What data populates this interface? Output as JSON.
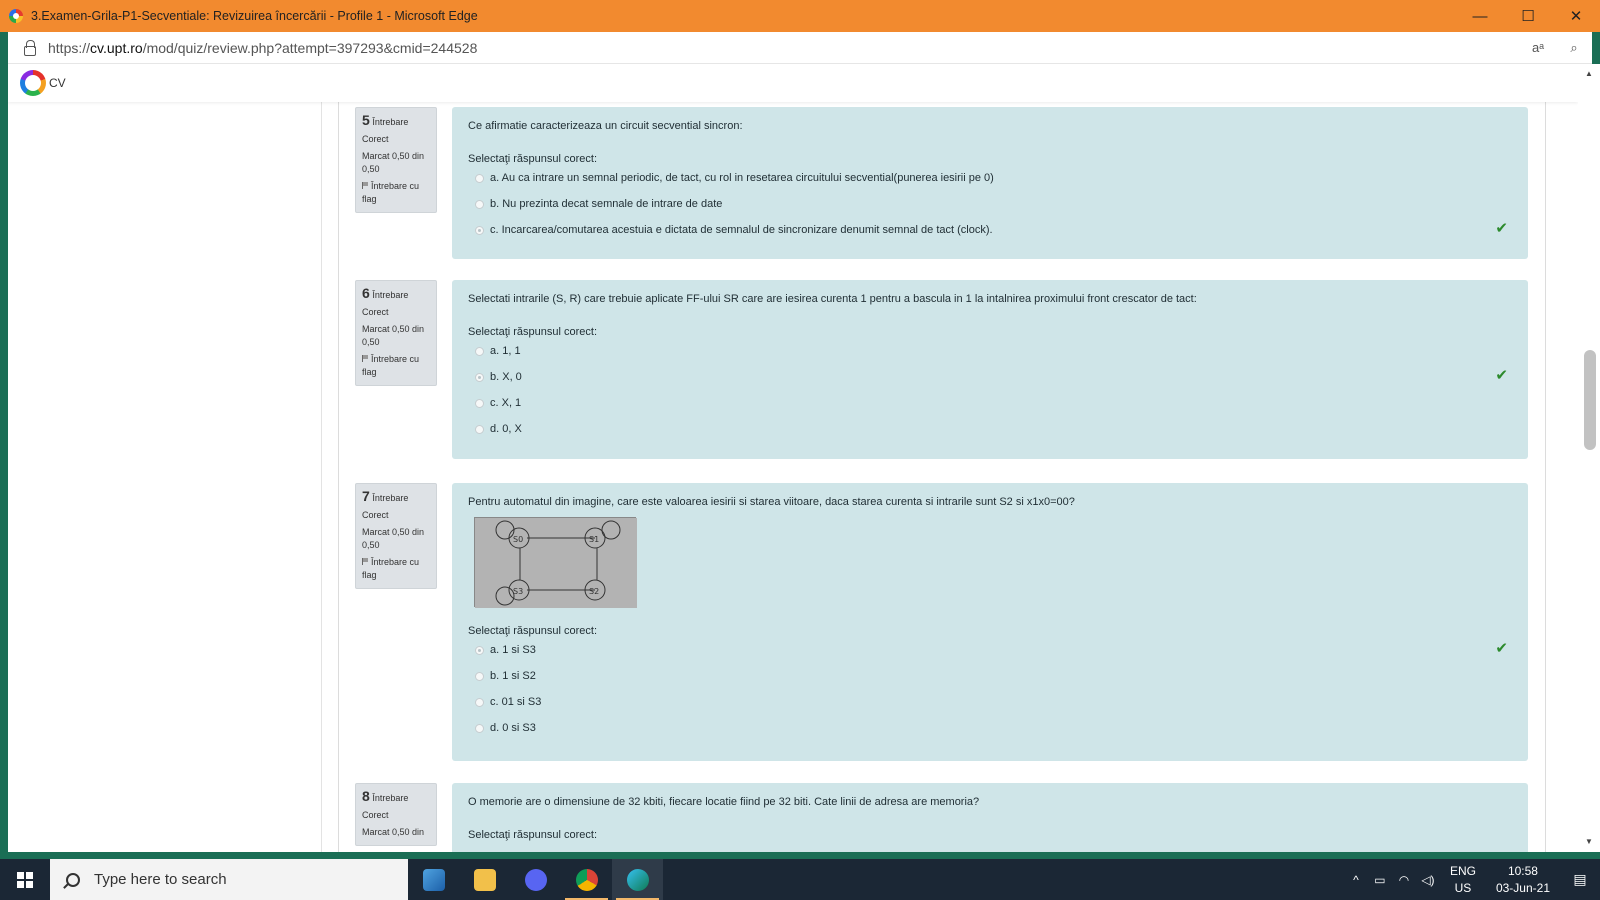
{
  "window": {
    "title": "3.Examen-Grila-P1-Secventiale: Revizuirea încercării - Profile 1 - Microsoft Edge",
    "url_prefix": "https://",
    "url_host": "cv.upt.ro",
    "url_path": "/mod/quiz/review.php?attempt=397293&cmid=244528",
    "minimize": "—",
    "maximize": "☐",
    "close": "✕"
  },
  "site": {
    "logo_text": "CV"
  },
  "questions": [
    {
      "number": "5",
      "word": "Întrebare",
      "state": "Corect",
      "mark": "Marcat 0,50 din 0,50",
      "flag": "Întrebare cu flag",
      "text": "Ce afirmatie caracterizeaza un circuit secvential sincron:",
      "prompt": "Selectaţi răspunsul corect:",
      "answers": [
        "a. Au ca intrare un semnal periodic, de tact, cu rol in resetarea circuitului secvential(punerea iesirii pe 0)",
        "b. Nu prezinta decat semnale de intrare de date",
        "c. Incarcarea/comutarea acestuia e dictata de semnalul de sincronizare denumit semnal de tact (clock)."
      ],
      "selected": 2
    },
    {
      "number": "6",
      "word": "Întrebare",
      "state": "Corect",
      "mark": "Marcat 0,50 din 0,50",
      "flag": "Întrebare cu flag",
      "text": "Selectati intrarile (S, R) care trebuie aplicate FF-ului SR care are iesirea curenta 1 pentru a bascula in 1 la intalnirea proximului front crescator de tact:",
      "prompt": "Selectaţi răspunsul corect:",
      "answers": [
        "a. 1, 1",
        "b. X, 0",
        "c. X, 1",
        "d. 0, X"
      ],
      "selected": 1
    },
    {
      "number": "7",
      "word": "Întrebare",
      "state": "Corect",
      "mark": "Marcat 0,50 din 0,50",
      "flag": "Întrebare cu flag",
      "text": "Pentru automatul din imagine, care este valoarea iesirii si starea viitoare, daca starea curenta si intrarile sunt S2 si x1x0=00?",
      "prompt": "Selectaţi răspunsul corect:",
      "answers": [
        "a. 1 si S3",
        "b. 1 si S2",
        "c. 01 si S3",
        "d. 0 si S3"
      ],
      "selected": 0,
      "image_labels": {
        "s0": "S0",
        "s1": "S1",
        "s2": "S2",
        "s3": "S3"
      }
    },
    {
      "number": "8",
      "word": "Întrebare",
      "state": "Corect",
      "mark": "Marcat 0,50 din",
      "text": "O memorie are o dimensiune de 32 kbiti, fiecare locatie fiind pe 32 biti. Cate linii de adresa are memoria?",
      "prompt": "Selectaţi răspunsul corect:"
    }
  ],
  "taskbar": {
    "search_placeholder": "Type here to search",
    "lang_top": "ENG",
    "lang_bottom": "US",
    "time": "10:58",
    "date": "03-Jun-21"
  }
}
